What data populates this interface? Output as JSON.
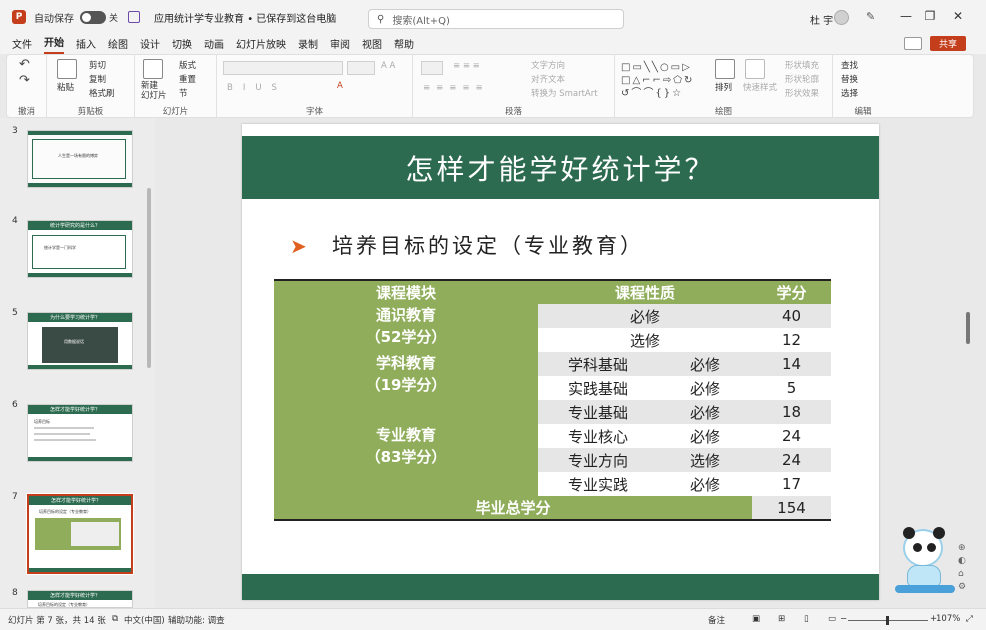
{
  "titlebar": {
    "autosave_label": "自动保存",
    "autosave_state": "关",
    "doc_title": "应用统计学专业教育 • 已保存到这台电脑",
    "search_placeholder": "搜索(Alt+Q)",
    "user_name": "杜 宇"
  },
  "menu": [
    "文件",
    "开始",
    "插入",
    "绘图",
    "设计",
    "切换",
    "动画",
    "幻灯片放映",
    "录制",
    "审阅",
    "视图",
    "帮助"
  ],
  "share_label": "共享",
  "ribbon": {
    "clipboard": {
      "label": "剪贴板",
      "paste": "粘贴",
      "cut": "剪切",
      "copy": "复制",
      "format_painter": "格式刷"
    },
    "undo_label": "撤消",
    "slides": {
      "label": "幻灯片",
      "new_slide": "新建\n幻灯片",
      "layout": "版式",
      "reset": "重置",
      "section": "节"
    },
    "font_label": "字体",
    "paragraph": {
      "label": "段落",
      "text_direction": "文字方向",
      "align_text": "对齐文本",
      "smartart": "转换为 SmartArt"
    },
    "drawing": {
      "label": "绘图",
      "arrange": "排列",
      "quick_styles": "快速样式",
      "shape_fill": "形状填充",
      "shape_outline": "形状轮廓",
      "shape_effects": "形状效果"
    },
    "editing": {
      "label": "编辑",
      "find": "查找",
      "replace": "替换",
      "select": "选择"
    }
  },
  "thumbnails": [
    {
      "num": "3",
      "title": "",
      "body": "人生是一场有限的博弈"
    },
    {
      "num": "4",
      "title": "统计学研究的是什么？",
      "body": "统计学是一门科学"
    },
    {
      "num": "5",
      "title": "为什么要学习统计学？",
      "body": "用数据说话"
    },
    {
      "num": "6",
      "title": "怎样才能学好统计学？",
      "body": "培养目标"
    },
    {
      "num": "7",
      "title": "怎样才能学好统计学？",
      "body": "培养目标的设定（专业教育）"
    },
    {
      "num": "8",
      "title": "怎样才能学好统计学？",
      "body": "培养目标的设定（专业教育）"
    }
  ],
  "slide": {
    "title": "怎样才能学好统计学？",
    "subtitle": "培养目标的设定（专业教育）",
    "table": {
      "headers": [
        "课程模块",
        "课程性质",
        "学分"
      ],
      "modules": [
        {
          "name": "通识教育",
          "credits": "（52学分）"
        },
        {
          "name": "学科教育",
          "credits": "（19学分）"
        },
        {
          "name": "专业教育",
          "credits": "（83学分）"
        }
      ],
      "rows": [
        {
          "course": "",
          "nature": "必修",
          "credit": "40"
        },
        {
          "course": "",
          "nature": "选修",
          "credit": "12"
        },
        {
          "course": "学科基础",
          "nature": "必修",
          "credit": "14"
        },
        {
          "course": "实践基础",
          "nature": "必修",
          "credit": "5"
        },
        {
          "course": "专业基础",
          "nature": "必修",
          "credit": "18"
        },
        {
          "course": "专业核心",
          "nature": "必修",
          "credit": "24"
        },
        {
          "course": "专业方向",
          "nature": "选修",
          "credit": "24"
        },
        {
          "course": "专业实践",
          "nature": "必修",
          "credit": "17"
        }
      ],
      "total_label": "毕业总学分",
      "total_value": "154"
    }
  },
  "statusbar": {
    "slide_info": "幻灯片 第 7 张，共 14 张",
    "language": "中文(中国)",
    "accessibility": "辅助功能: 调查",
    "notes": "备注",
    "zoom": "107%"
  },
  "colors": {
    "accent": "#c43e1c",
    "slide_green": "#2d6b50",
    "table_green": "#8fad5a"
  }
}
